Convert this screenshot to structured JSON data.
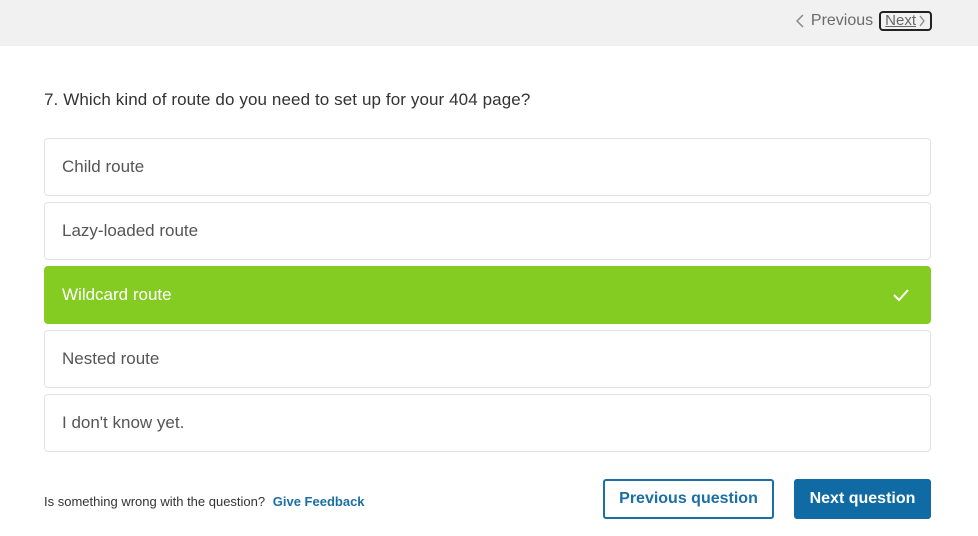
{
  "nav": {
    "previous_label": "Previous",
    "next_label": "Next"
  },
  "question": {
    "text": "7. Which kind of route do you need to set up for your 404 page?"
  },
  "options": [
    {
      "label": "Child route",
      "selected": false
    },
    {
      "label": "Lazy-loaded route",
      "selected": false
    },
    {
      "label": "Wildcard route",
      "selected": true
    },
    {
      "label": "Nested route",
      "selected": false
    },
    {
      "label": "I don't know yet.",
      "selected": false
    }
  ],
  "footer": {
    "prompt": "Is something wrong with the question?",
    "feedback_link": "Give Feedback",
    "previous_question_label": "Previous question",
    "next_question_label": "Next question"
  },
  "colors": {
    "selected_bg": "#84cc22",
    "primary": "#106aa3",
    "link": "#1a6fa5",
    "topbar_bg": "#f1f1f1"
  },
  "icons": {
    "previous": "chevron-left-icon",
    "next": "chevron-right-icon",
    "selected": "checkmark-icon"
  }
}
